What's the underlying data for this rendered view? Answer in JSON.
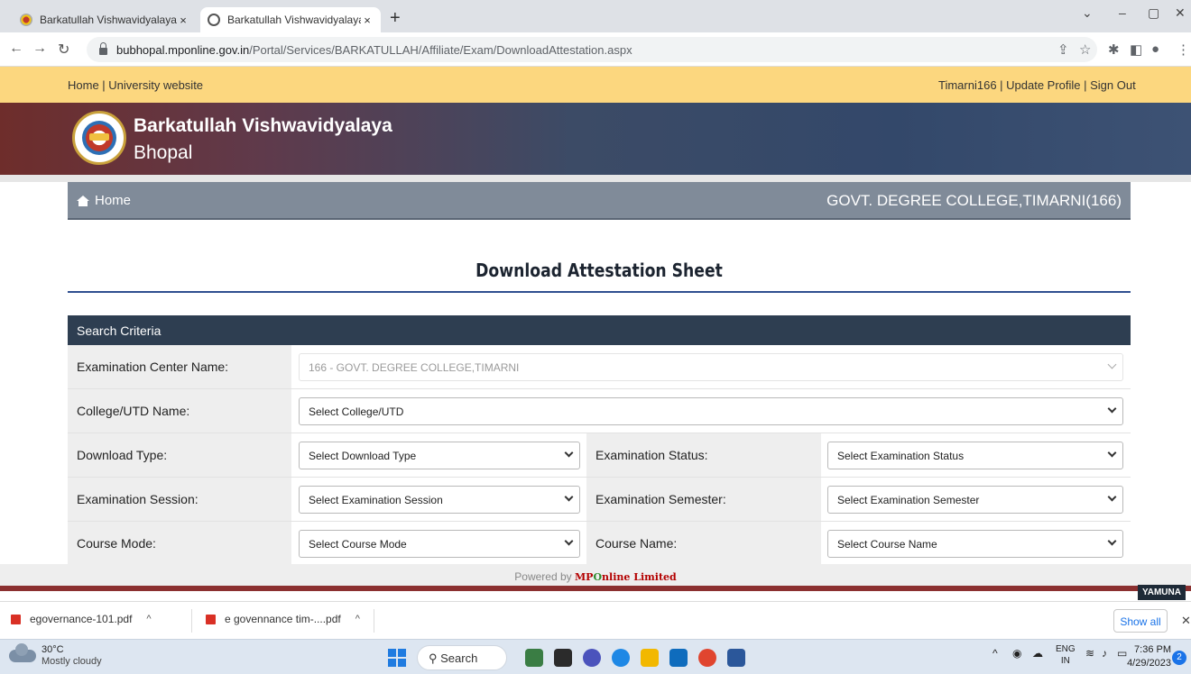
{
  "browser": {
    "tabs": [
      {
        "title": "Barkatullah Vishwavidyalaya,Bhop",
        "close": "×"
      },
      {
        "title": "Barkatullah Vishwavidyalaya,Bhop",
        "close": "×"
      }
    ],
    "new_tab": "+",
    "url_host": "bubhopal.mponline.gov.in",
    "url_path": "/Portal/Services/BARKATULLAH/Affiliate/Exam/DownloadAttestation.aspx"
  },
  "topbar": {
    "left_links": "Home | University website",
    "right_links": "Timarni166 | Update Profile | Sign Out"
  },
  "banner": {
    "line1": "Barkatullah Vishwavidyalaya",
    "line2": "Bhopal"
  },
  "nav": {
    "home": "Home",
    "college": "GOVT. DEGREE COLLEGE,TIMARNI(166)"
  },
  "page": {
    "title": "Download Attestation Sheet",
    "section": "Search Criteria"
  },
  "form": {
    "exam_center_label": "Examination Center Name:",
    "exam_center_value": "166 - GOVT. DEGREE COLLEGE,TIMARNI",
    "college_label": "College/UTD Name:",
    "college_value": "Select College/UTD",
    "download_type_label": "Download Type:",
    "download_type_value": "Select Download Type",
    "exam_status_label": "Examination Status:",
    "exam_status_value": "Select Examination Status",
    "exam_session_label": "Examination Session:",
    "exam_session_value": "Select Examination Session",
    "exam_semester_label": "Examination Semester:",
    "exam_semester_value": "Select Examination Semester",
    "course_mode_label": "Course Mode:",
    "course_mode_value": "Select Course Mode",
    "course_name_label": "Course Name:",
    "course_name_value": "Select Course Name"
  },
  "footer": {
    "powered_by": "Powered by",
    "mp": "MP",
    "o": "O",
    "online": "nline Limited",
    "badge": "YAMUNA"
  },
  "downloads": {
    "items": [
      "egovernance-101.pdf",
      "e govennance tim-....pdf"
    ],
    "show_all": "Show all"
  },
  "taskbar": {
    "temp": "30°C",
    "weather": "Mostly cloudy",
    "search": "Search",
    "lang1": "ENG",
    "lang2": "IN",
    "time": "7:36 PM",
    "date": "4/29/2023",
    "notifications": "2"
  }
}
